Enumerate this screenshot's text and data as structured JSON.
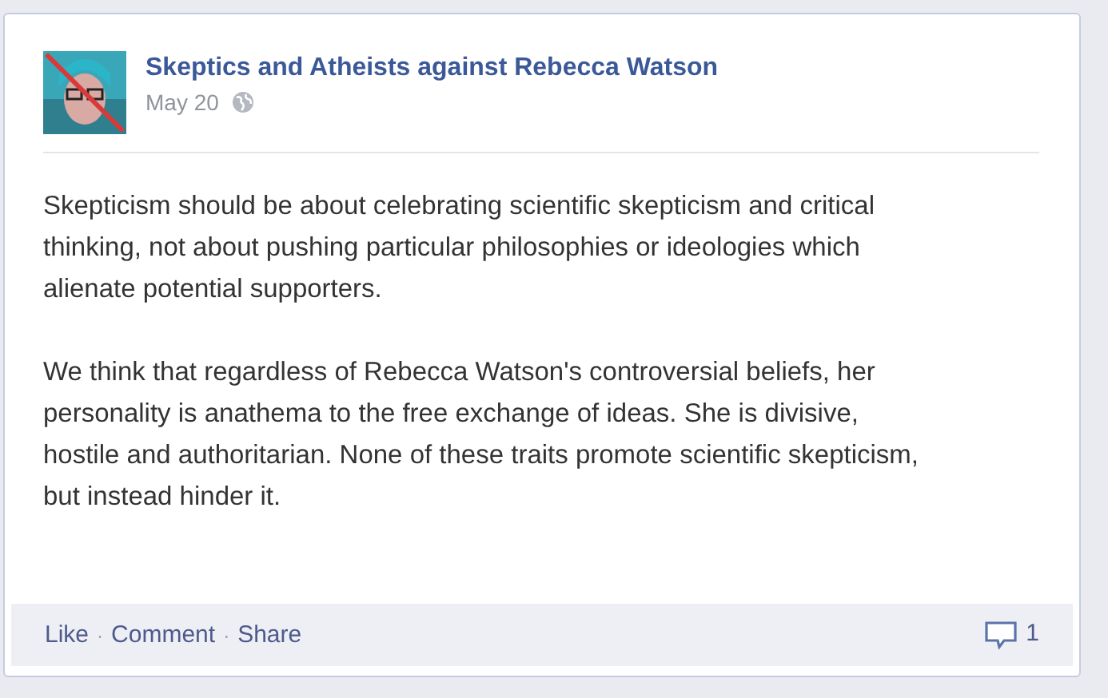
{
  "post": {
    "author": "Skeptics and Atheists against Rebecca Watson",
    "date": "May 20",
    "avatar": {
      "kind": "picture"
    },
    "paragraphs": [
      "Skepticism should be about celebrating scientific skepticism and critical thinking, not about pushing particular philosophies or ideologies which alienate potential supporters.",
      "We think that regardless of Rebecca Watson's controversial beliefs, her personality is anathema to the free exchange of ideas. She is divisive, hostile and authoritarian. None of these traits promote scientific skepticism, but instead hinder it."
    ],
    "actions": [
      "Like",
      "Comment",
      "Share"
    ],
    "separator": "·",
    "comment_count": "1"
  }
}
